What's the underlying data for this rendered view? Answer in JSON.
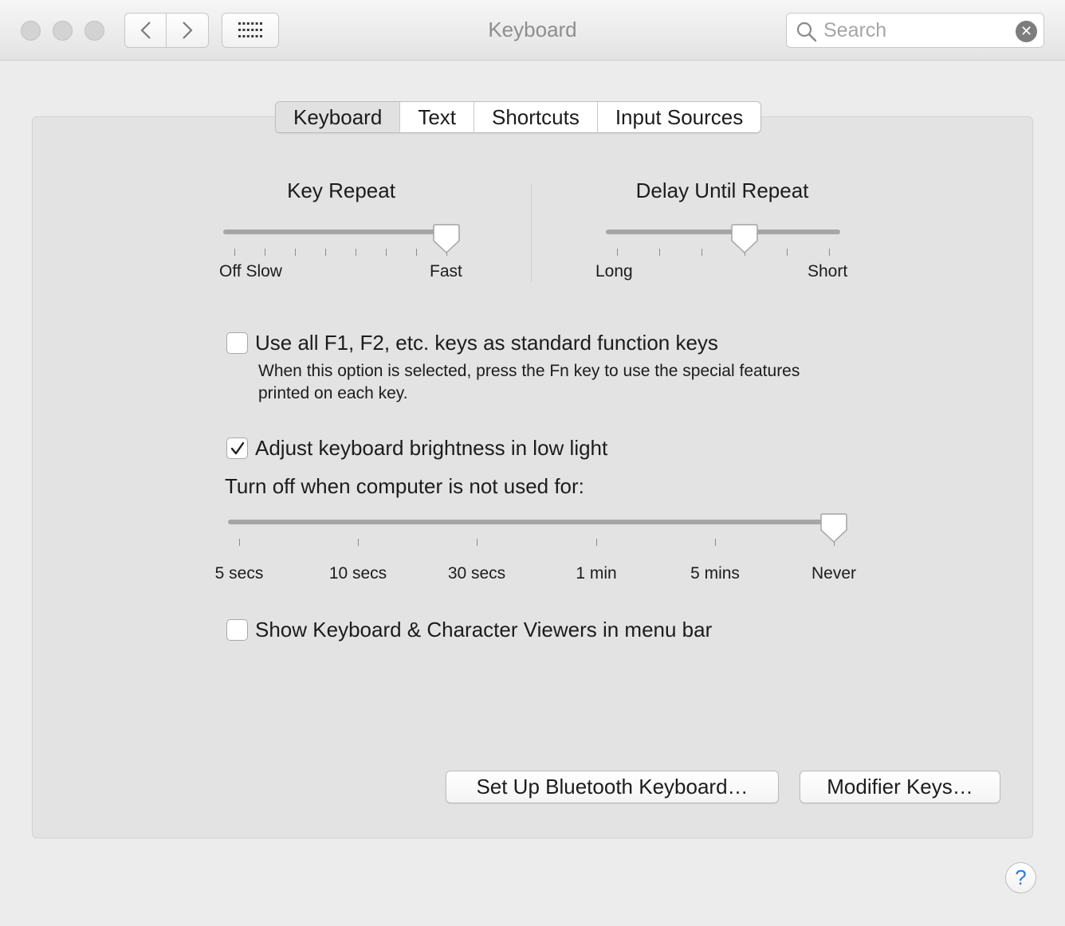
{
  "window": {
    "title": "Keyboard"
  },
  "search": {
    "placeholder": "Search"
  },
  "tabs": [
    {
      "label": "Keyboard",
      "selected": true
    },
    {
      "label": "Text",
      "selected": false
    },
    {
      "label": "Shortcuts",
      "selected": false
    },
    {
      "label": "Input Sources",
      "selected": false
    }
  ],
  "key_repeat": {
    "title": "Key Repeat",
    "min_label": "Off Slow",
    "max_label": "Fast",
    "tick_count": 8,
    "value_step": 7
  },
  "delay_until_repeat": {
    "title": "Delay Until Repeat",
    "min_label": "Long",
    "max_label": "Short",
    "tick_count": 6,
    "value_step": 3
  },
  "function_keys": {
    "label": "Use all F1, F2, etc. keys as standard function keys",
    "description": "When this option is selected, press the Fn key to use the special features printed on each key.",
    "checked": false
  },
  "brightness": {
    "label": "Adjust keyboard brightness in low light",
    "checked": true
  },
  "turn_off": {
    "label": "Turn off when computer is not used for:",
    "options": [
      "5 secs",
      "10 secs",
      "30 secs",
      "1 min",
      "5 mins",
      "Never"
    ],
    "selected": "Never"
  },
  "viewers": {
    "label": "Show Keyboard & Character Viewers in menu bar",
    "checked": false
  },
  "buttons": {
    "bluetooth": "Set Up Bluetooth Keyboard…",
    "modifier": "Modifier Keys…",
    "help": "?"
  },
  "colors": {
    "help_accent": "#2a7ae2",
    "title_text": "#8e8e8e"
  }
}
